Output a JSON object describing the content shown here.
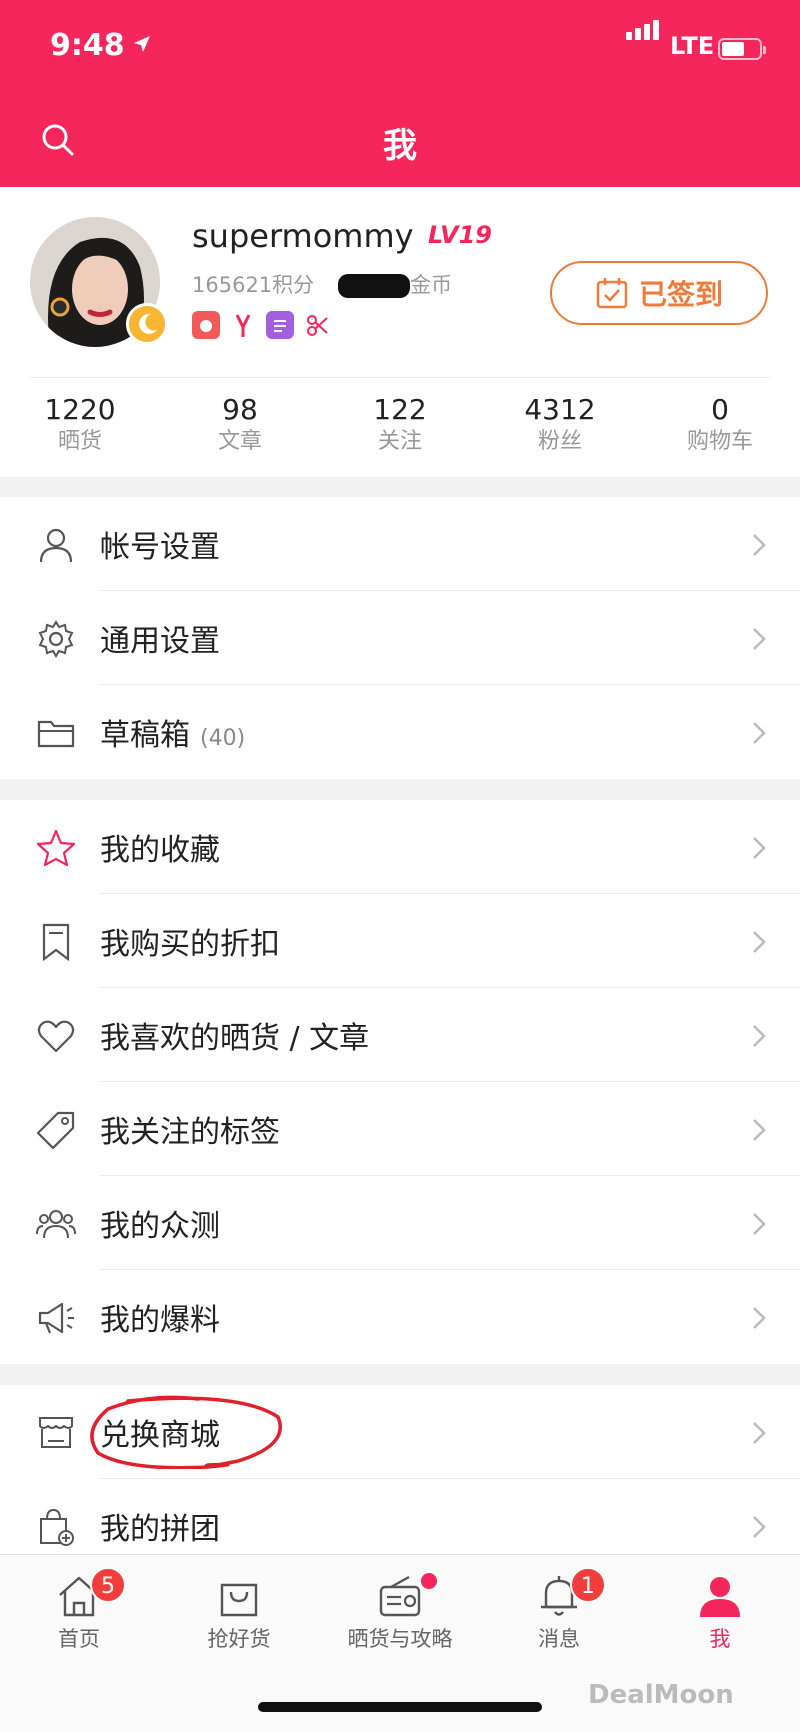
{
  "status_bar": {
    "time": "9:48",
    "network": "LTE"
  },
  "header": {
    "title": "我"
  },
  "profile": {
    "username": "supermommy",
    "level": "LV19",
    "points": "165621积分",
    "coins_suffix": "金币",
    "checkin_label": "已签到",
    "stats": [
      {
        "value": "1220",
        "label": "晒货"
      },
      {
        "value": "98",
        "label": "文章"
      },
      {
        "value": "122",
        "label": "关注"
      },
      {
        "value": "4312",
        "label": "粉丝"
      },
      {
        "value": "0",
        "label": "购物车"
      }
    ]
  },
  "menu_groups": [
    [
      {
        "label": "帐号设置",
        "icon": "person-icon"
      },
      {
        "label": "通用设置",
        "icon": "gear-icon"
      },
      {
        "label": "草稿箱",
        "count": "(40)",
        "icon": "folder-icon"
      }
    ],
    [
      {
        "label": "我的收藏",
        "icon": "star-icon"
      },
      {
        "label": "我购买的折扣",
        "icon": "bookmark-icon"
      },
      {
        "label": "我喜欢的晒货 / 文章",
        "icon": "heart-icon"
      },
      {
        "label": "我关注的标签",
        "icon": "tag-icon"
      },
      {
        "label": "我的众测",
        "icon": "group-icon"
      },
      {
        "label": "我的爆料",
        "icon": "megaphone-icon"
      }
    ],
    [
      {
        "label": "兑换商城",
        "icon": "store-icon"
      },
      {
        "label": "我的拼团",
        "icon": "shopping-bag-icon"
      }
    ]
  ],
  "bottom_nav": [
    {
      "label": "首页",
      "badge": "5"
    },
    {
      "label": "抢好货"
    },
    {
      "label": "晒货与攻略"
    },
    {
      "label": "消息",
      "badge": "1"
    },
    {
      "label": "我"
    }
  ],
  "watermark": "DealMoon",
  "colors": {
    "brand": "#f5265c",
    "checkin": "#ef7a3a",
    "badge": "#f23d3d"
  }
}
